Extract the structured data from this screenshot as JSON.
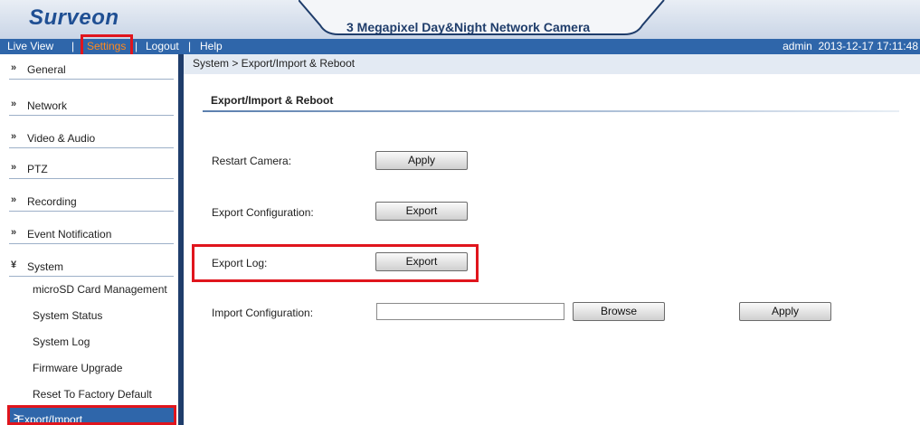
{
  "header": {
    "logo": "Surveon",
    "title": "3 Megapixel Day&Night Network Camera"
  },
  "nav": {
    "live_view": "Live View",
    "settings": "Settings",
    "logout": "Logout",
    "help": "Help",
    "sep": "|",
    "user": "admin",
    "datetime": "2013-12-17  17:11:48"
  },
  "sidebar": {
    "chevron": "»",
    "chevron_open": "¥",
    "sections": [
      "General",
      "Network",
      "Video & Audio",
      "PTZ",
      "Recording",
      "Event Notification",
      "System"
    ],
    "system_items": [
      "microSD Card Management",
      "System Status",
      "System Log",
      "Firmware Upgrade",
      "Reset To Factory Default"
    ],
    "active_item": "Export/Import & Reboot",
    "active_marker": ">"
  },
  "main": {
    "breadcrumb": "System > Export/Import & Reboot",
    "section_title": "Export/Import & Reboot",
    "rows": {
      "restart_label": "Restart Camera:",
      "restart_button": "Apply",
      "export_config_label": "Export Configuration:",
      "export_config_button": "Export",
      "export_log_label": "Export Log:",
      "export_log_button": "Export",
      "import_config_label": "Import Configuration:",
      "import_config_value": "",
      "browse_button": "Browse",
      "import_apply_button": "Apply"
    }
  },
  "colors": {
    "nav_bg": "#2f66aa",
    "highlight": "#e0151d",
    "settings_active": "#ff8a1e"
  }
}
